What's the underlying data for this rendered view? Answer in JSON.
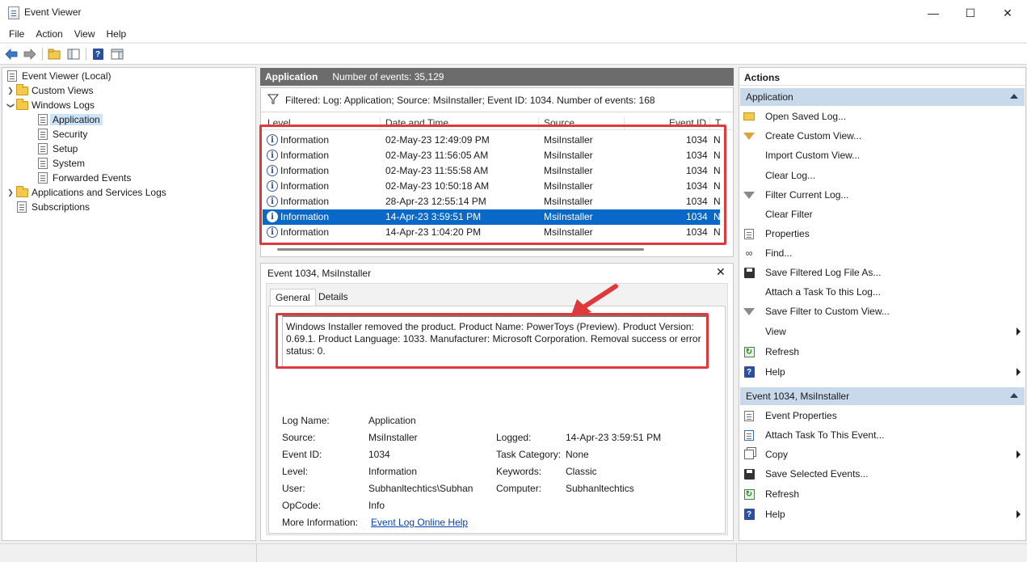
{
  "window": {
    "title": "Event Viewer",
    "minimize_glyph": "—",
    "maximize_glyph": "☐",
    "close_glyph": "✕"
  },
  "menu": [
    "File",
    "Action",
    "View",
    "Help"
  ],
  "toolbar_icons": [
    "back-arrow-icon",
    "forward-arrow-icon",
    "open-folder-icon",
    "show-hide-tree-icon",
    "help-icon",
    "show-hide-action-pane-icon"
  ],
  "tree": {
    "root": "Event Viewer (Local)",
    "custom_views": "Custom Views",
    "windows_logs": "Windows Logs",
    "logs": [
      "Application",
      "Security",
      "Setup",
      "System",
      "Forwarded Events"
    ],
    "app_services": "Applications and Services Logs",
    "subscriptions": "Subscriptions"
  },
  "center": {
    "header_title": "Application",
    "header_count": "Number of events: 35,129",
    "filter_text": "Filtered: Log: Application; Source: MsiInstaller; Event ID: 1034. Number of events: 168",
    "columns": [
      "Level",
      "Date and Time",
      "Source",
      "Event ID",
      "T"
    ],
    "rows": [
      {
        "level": "Information",
        "date": "02-May-23 12:49:09 PM",
        "source": "MsiInstaller",
        "id": "1034",
        "task": "N"
      },
      {
        "level": "Information",
        "date": "02-May-23 11:56:05 AM",
        "source": "MsiInstaller",
        "id": "1034",
        "task": "N"
      },
      {
        "level": "Information",
        "date": "02-May-23 11:55:58 AM",
        "source": "MsiInstaller",
        "id": "1034",
        "task": "N"
      },
      {
        "level": "Information",
        "date": "02-May-23 10:50:18 AM",
        "source": "MsiInstaller",
        "id": "1034",
        "task": "N"
      },
      {
        "level": "Information",
        "date": "28-Apr-23 12:55:14 PM",
        "source": "MsiInstaller",
        "id": "1034",
        "task": "N"
      },
      {
        "level": "Information",
        "date": "14-Apr-23 3:59:51 PM",
        "source": "MsiInstaller",
        "id": "1034",
        "task": "N"
      },
      {
        "level": "Information",
        "date": "14-Apr-23 1:04:20 PM",
        "source": "MsiInstaller",
        "id": "1034",
        "task": "N"
      }
    ]
  },
  "detail": {
    "title": "Event 1034, MsiInstaller",
    "tabs": [
      "General",
      "Details"
    ],
    "description": "Windows Installer removed the product. Product Name: PowerToys (Preview). Product Version: 0.69.1. Product Language: 1033. Manufacturer: Microsoft Corporation. Removal success or error status: 0.",
    "labels": {
      "log_name": "Log Name:",
      "source": "Source:",
      "event_id": "Event ID:",
      "level": "Level:",
      "user": "User:",
      "opcode": "OpCode:",
      "more_info": "More Information:",
      "logged": "Logged:",
      "task_category": "Task Category:",
      "keywords": "Keywords:",
      "computer": "Computer:"
    },
    "values": {
      "log_name": "Application",
      "source": "MsiInstaller",
      "event_id": "1034",
      "level": "Information",
      "user": "Subhanltechtics\\Subhan",
      "opcode": "Info",
      "more_info": "Event Log Online Help",
      "logged": "14-Apr-23 3:59:51 PM",
      "task_category": "None",
      "keywords": "Classic",
      "computer": "Subhanltechtics"
    }
  },
  "actions": {
    "title": "Actions",
    "section1": "Application",
    "section1_items": [
      {
        "label": "Open Saved Log...",
        "icon": "open-folder-icon",
        "submenu": false
      },
      {
        "label": "Create Custom View...",
        "icon": "filter-funnel-icon",
        "submenu": false
      },
      {
        "label": "Import Custom View...",
        "icon": "",
        "submenu": false
      },
      {
        "label": "Clear Log...",
        "icon": "",
        "submenu": false
      },
      {
        "label": "Filter Current Log...",
        "icon": "filter-funnel-icon",
        "submenu": false
      },
      {
        "label": "Clear Filter",
        "icon": "",
        "submenu": false
      },
      {
        "label": "Properties",
        "icon": "properties-icon",
        "submenu": false
      },
      {
        "label": "Find...",
        "icon": "find-binoculars-icon",
        "submenu": false
      },
      {
        "label": "Save Filtered Log File As...",
        "icon": "save-disk-icon",
        "submenu": false
      },
      {
        "label": "Attach a Task To this Log...",
        "icon": "",
        "submenu": false
      },
      {
        "label": "Save Filter to Custom View...",
        "icon": "filter-funnel-icon",
        "submenu": false
      },
      {
        "label": "View",
        "icon": "",
        "submenu": true
      },
      {
        "label": "Refresh",
        "icon": "refresh-icon",
        "submenu": false
      },
      {
        "label": "Help",
        "icon": "help-icon",
        "submenu": true
      }
    ],
    "section2": "Event 1034, MsiInstaller",
    "section2_items": [
      {
        "label": "Event Properties",
        "icon": "properties-icon",
        "submenu": false
      },
      {
        "label": "Attach Task To This Event...",
        "icon": "task-icon",
        "submenu": false
      },
      {
        "label": "Copy",
        "icon": "copy-icon",
        "submenu": true
      },
      {
        "label": "Save Selected Events...",
        "icon": "save-disk-icon",
        "submenu": false
      },
      {
        "label": "Refresh",
        "icon": "refresh-icon",
        "submenu": false
      },
      {
        "label": "Help",
        "icon": "help-icon",
        "submenu": true
      }
    ]
  },
  "colors": {
    "selection": "#0a68c8",
    "tree_selection": "#cce4f7",
    "section_header": "#c9d9ec",
    "annotation_red": "#e0393c",
    "center_header": "#6c6c6c"
  }
}
